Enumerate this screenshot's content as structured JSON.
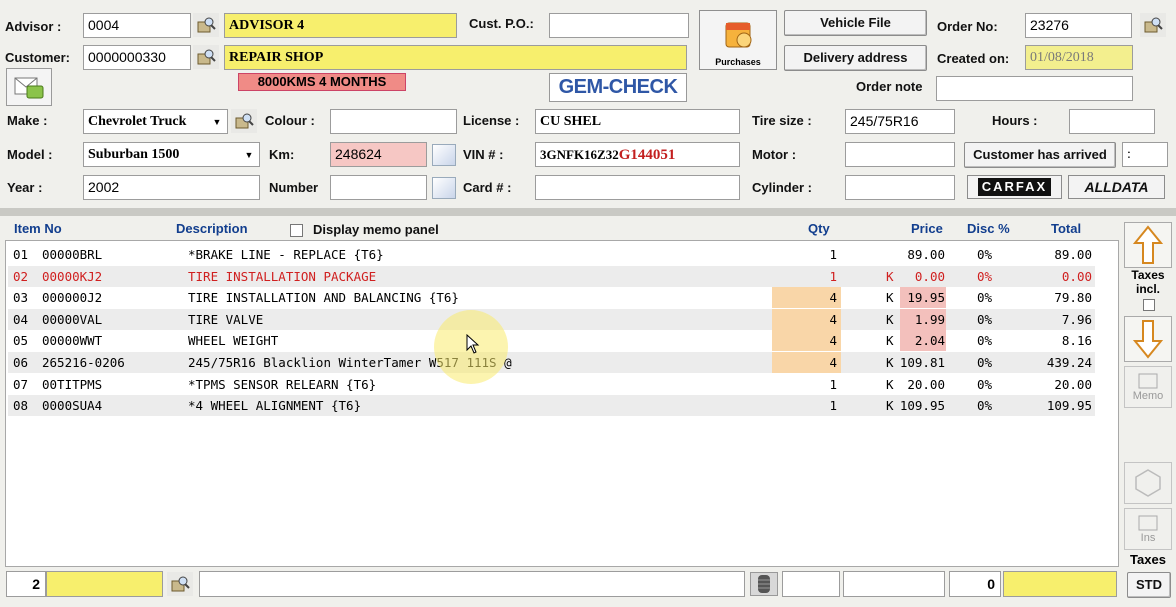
{
  "header": {
    "advisor_label": "Advisor :",
    "advisor_code": "0004",
    "advisor_name": "ADVISOR 4",
    "cust_po_label": "Cust. P.O.:",
    "cust_po_value": "",
    "customer_label": "Customer:",
    "customer_code": "0000000330",
    "customer_name": "REPAIR SHOP",
    "customer_note": "8000KMS 4 MONTHS",
    "gemcheck_label": "GEM-CHECK",
    "purchases_label": "Purchases",
    "vehicle_file_label": "Vehicle File",
    "delivery_address_label": "Delivery address",
    "order_no_label": "Order No:",
    "order_no_value": "23276",
    "created_on_label": "Created on:",
    "created_on_value": "01/08/2018",
    "order_note_label": "Order note",
    "order_note_value": ""
  },
  "vehicle": {
    "make_label": "Make :",
    "make_value": "Chevrolet Truck",
    "model_label": "Model :",
    "model_value": "Suburban 1500",
    "year_label": "Year :",
    "year_value": "2002",
    "colour_label": "Colour :",
    "colour_value": "",
    "km_label": "Km:",
    "km_value": "248624",
    "number_label": "Number",
    "number_value": "",
    "license_label": "License :",
    "license_value": "CU SHEL",
    "vin_label": "VIN # :",
    "vin_prefix": "3GNFK16Z32",
    "vin_suffix": "G144051",
    "card_label": "Card # :",
    "card_value": "",
    "tire_size_label": "Tire size :",
    "tire_size_value": "245/75R16",
    "motor_label": "Motor :",
    "motor_value": "",
    "cylinder_label": "Cylinder :",
    "cylinder_value": "",
    "hours_label": "Hours :",
    "hours_value": "",
    "customer_arrived_label": "Customer has arrived",
    "customer_arrived_value": ":",
    "carfax_label": "CARFAX",
    "alldata_label": "ALLDATA"
  },
  "grid": {
    "col_item": "Item No",
    "col_description": "Description",
    "memo_panel_label": "Display memo panel",
    "col_qty": "Qty",
    "col_price": "Price",
    "col_disc": "Disc %",
    "col_total": "Total",
    "rows": [
      {
        "line": "01",
        "item": "00000BRL",
        "desc": "*BRAKE LINE - REPLACE {T6}",
        "qty": "1",
        "flag": "",
        "price": "89.00",
        "disc": "0%",
        "total": "89.00"
      },
      {
        "line": "02",
        "item": "00000KJ2",
        "desc": "TIRE INSTALLATION PACKAGE",
        "qty": "1",
        "flag": "K",
        "price": "0.00",
        "disc": "0%",
        "total": "0.00"
      },
      {
        "line": "03",
        "item": "000000J2",
        "desc": "TIRE INSTALLATION AND BALANCING {T6}",
        "qty": "4",
        "flag": "K",
        "price": "19.95",
        "disc": "0%",
        "total": "79.80"
      },
      {
        "line": "04",
        "item": "00000VAL",
        "desc": "TIRE VALVE",
        "qty": "4",
        "flag": "K",
        "price": "1.99",
        "disc": "0%",
        "total": "7.96"
      },
      {
        "line": "05",
        "item": "00000WWT",
        "desc": "WHEEL WEIGHT",
        "qty": "4",
        "flag": "K",
        "price": "2.04",
        "disc": "0%",
        "total": "8.16"
      },
      {
        "line": "06",
        "item": "265216-0206",
        "desc": "245/75R16 Blacklion WinterTamer W517 111S  @",
        "qty": "4",
        "flag": "K",
        "price": "109.81",
        "disc": "0%",
        "total": "439.24"
      },
      {
        "line": "07",
        "item": "00TITPMS",
        "desc": "*TPMS SENSOR RELEARN {T6}",
        "qty": "1",
        "flag": "K",
        "price": "20.00",
        "disc": "0%",
        "total": "20.00"
      },
      {
        "line": "08",
        "item": "0000SUA4",
        "desc": "*4 WHEEL ALIGNMENT {T6}",
        "qty": "1",
        "flag": "K",
        "price": "109.95",
        "disc": "0%",
        "total": "109.95"
      }
    ]
  },
  "side": {
    "taxes_incl_line1": "Taxes",
    "taxes_incl_line2": "incl.",
    "memo_label": "Memo",
    "ins_label": "Ins",
    "taxes_label": "Taxes",
    "std_label": "STD"
  },
  "status": {
    "line_count": "2",
    "right_count": "0"
  }
}
